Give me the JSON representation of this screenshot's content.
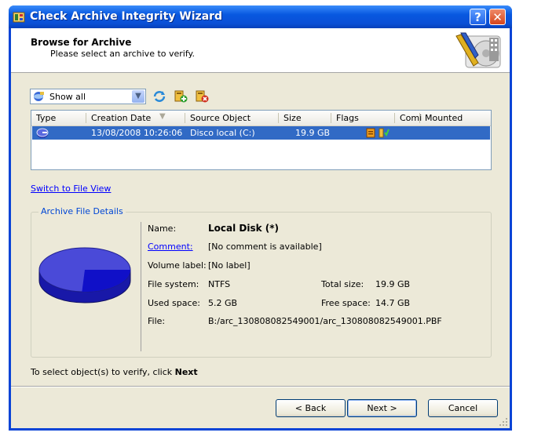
{
  "window": {
    "title": "Check Archive Integrity Wizard",
    "help_glyph": "?",
    "close_glyph": "✕"
  },
  "header": {
    "title": "Browse for Archive",
    "subtitle": "Please select an archive to verify."
  },
  "toolbar": {
    "filter_value": "Show all",
    "icons": [
      "refresh-icon",
      "add-archive-icon",
      "remove-archive-icon"
    ]
  },
  "list": {
    "columns": [
      "Type",
      "Creation Date",
      "Source Object",
      "Size",
      "Flags",
      "Comi",
      "Mounted"
    ],
    "rows": [
      {
        "type_icon": "disk-archive-icon",
        "creation_date": "13/08/2008 10:26:06",
        "source_object": "Disco local (C:)",
        "size": "19.9 GB",
        "flags_icons": [
          "flag-icon",
          "flag-icon"
        ],
        "comment": "",
        "mounted": ""
      }
    ]
  },
  "switch_link": "Switch to File View",
  "details": {
    "legend": "Archive File Details",
    "name_label": "Name:",
    "name_value": "Local Disk (*)",
    "comment_label": "Comment:",
    "comment_value": "[No comment is available]",
    "volume_label_label": "Volume label:",
    "volume_label_value": "[No label]",
    "file_system_label": "File system:",
    "file_system_value": "NTFS",
    "total_size_label": "Total size:",
    "total_size_value": "19.9 GB",
    "used_space_label": "Used space:",
    "used_space_value": "5.2 GB",
    "free_space_label": "Free space:",
    "free_space_value": "14.7 GB",
    "file_label": "File:",
    "file_value": "B:/arc_130808082549001/arc_130808082549001.PBF",
    "used_fraction": 0.26
  },
  "footer": {
    "hint_prefix": "To select object(s) to verify, click ",
    "hint_bold": "Next"
  },
  "buttons": {
    "back": "< Back",
    "next": "Next >",
    "cancel": "Cancel"
  },
  "colors": {
    "title_bar": "#0a4fd6",
    "selection": "#316ac5",
    "pie_free": "#4a4ad8",
    "pie_used": "#1010c8",
    "legend_text": "#0046d5"
  }
}
